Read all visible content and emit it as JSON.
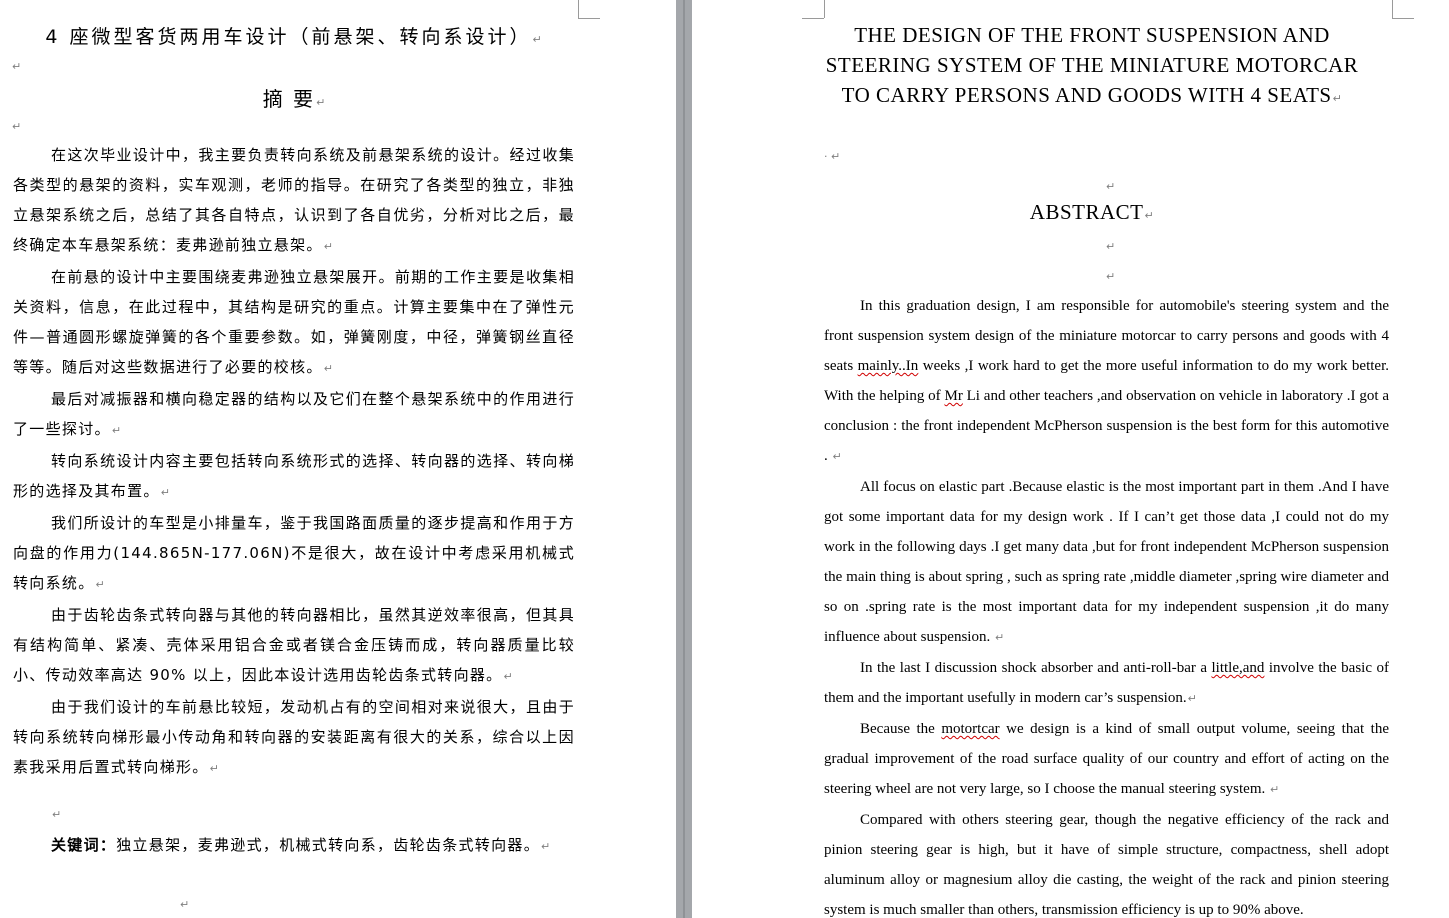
{
  "left_page": {
    "title": "4 座微型客货两用车设计（前悬架、转向系设计）",
    "abstract_heading": "摘 要",
    "paragraphs": [
      "在这次毕业设计中，我主要负责转向系统及前悬架系统的设计。经过收集各类型的悬架的资料，实车观测，老师的指导。在研究了各类型的独立，非独立悬架系统之后，总结了其各自特点，认识到了各自优劣，分析对比之后，最终确定本车悬架系统：麦弗逊前独立悬架。",
      "在前悬的设计中主要围绕麦弗逊独立悬架展开。前期的工作主要是收集相关资料，信息，在此过程中，其结构是研究的重点。计算主要集中在了弹性元件—普通圆形螺旋弹簧的各个重要参数。如，弹簧刚度，中径，弹簧钢丝直径等等。随后对这些数据进行了必要的校核。",
      "最后对减振器和横向稳定器的结构以及它们在整个悬架系统中的作用进行了一些探讨。",
      "转向系统设计内容主要包括转向系统形式的选择、转向器的选择、转向梯形的选择及其布置。",
      "我们所设计的车型是小排量车，鉴于我国路面质量的逐步提高和作用于方向盘的作用力(144.865N-177.06N)不是很大，故在设计中考虑采用机械式转向系统。",
      "由于齿轮齿条式转向器与其他的转向器相比，虽然其逆效率很高，但其具有结构简单、紧凑、壳体采用铝合金或者镁合金压铸而成，转向器质量比较小、传动效率高达 90% 以上，因此本设计选用齿轮齿条式转向器。",
      "由于我们设计的车前悬比较短，发动机占有的空间相对来说很大，且由于转向系统转向梯形最小传动角和转向器的安装距离有很大的关系，综合以上因素我采用后置式转向梯形。"
    ],
    "keywords_label": "关键词：",
    "keywords_text": "独立悬架，麦弗逊式，机械式转向系，齿轮齿条式转向器。"
  },
  "right_page": {
    "title": "THE DESIGN OF THE FRONT SUSPENSION AND STEERING SYSTEM OF THE MINIATURE MOTORCAR TO CARRY PERSONS AND GOODS WITH 4 SEATS",
    "abstract_heading": "ABSTRACT",
    "p1_a": "In this graduation design, I am responsible for automobile's steering system and the front suspension system design of the miniature motorcar to carry persons and goods with 4 seats ",
    "p1_b": "mainly..In",
    "p1_c": " weeks ,I work hard to get the more useful information to do my work better. With the helping of ",
    "p1_d": "Mr",
    "p1_e": " Li and other  teachers ,and observation on vehicle in laboratory .I got a conclusion : the front independent McPherson suspension is the best form for this automotive .",
    "p2": "All focus on elastic part .Because elastic is the most important part in them .And I have got some important data for my design work . If I can’t get those data ,I could not do my work in the following days .I get many data ,but for front independent McPherson suspension the main thing is about spring , such as spring rate ,middle diameter ,spring wire diameter and so on .spring rate is the most important data for my independent suspension ,it do many influence about suspension.",
    "p3_a": "In the last I discussion shock absorber and anti-roll-bar a ",
    "p3_b": "little,and",
    "p3_c": " involve the basic of them and the important usefully in modern car’s suspension.",
    "p4_a": "Because the ",
    "p4_b": "motortcar",
    "p4_c": " we design is a kind of small output volume, seeing that the gradual improvement of the road surface quality of our country and effort of acting on the steering wheel are not very large, so I choose the manual steering system.",
    "p5": "Compared with others steering gear, though the negative efficiency of the rack and pinion steering gear is high, but it have of simple structure, compactness, shell adopt aluminum alloy or magnesium alloy die casting, the weight of the rack and pinion steering system is much smaller than others, transmission efficiency is up to 90% above."
  },
  "marks": {
    "paragraph_mark": "↵",
    "dot": "·"
  }
}
